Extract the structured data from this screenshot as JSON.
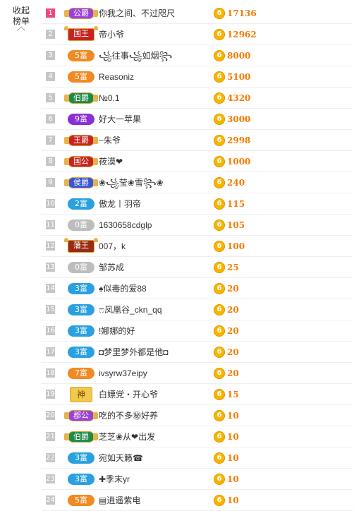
{
  "collapse_label": "收起榜单",
  "coin_glyph": "6",
  "rows": [
    {
      "rank": "1",
      "badge": "公爵",
      "badge_color": "#9b42d8",
      "badge_style": "wing",
      "name": "你我之间、不过咫尺",
      "score": "17136"
    },
    {
      "rank": "2",
      "badge": "国王",
      "badge_color": "#c8241f",
      "badge_style": "crown",
      "name": "帝小爷",
      "score": "12962"
    },
    {
      "rank": "3",
      "badge": "5富",
      "badge_color": "#f08a24",
      "badge_style": "plain",
      "name": "꧁往事꧁如烟꧂",
      "score": "8000"
    },
    {
      "rank": "4",
      "badge": "5富",
      "badge_color": "#f08a24",
      "badge_style": "plain",
      "name": "Reasoniz",
      "score": "5100"
    },
    {
      "rank": "5",
      "badge": "伯爵",
      "badge_color": "#1e8a4a",
      "badge_style": "wing",
      "name": "№0.1",
      "score": "4320"
    },
    {
      "rank": "6",
      "badge": "9富",
      "badge_color": "#8a2fd6",
      "badge_style": "plain",
      "name": "好大一苹果",
      "score": "3000"
    },
    {
      "rank": "7",
      "badge": "王爵",
      "badge_color": "#c8241f",
      "badge_style": "wing",
      "name": "~朱爷",
      "score": "2998"
    },
    {
      "rank": "8",
      "badge": "国公",
      "badge_color": "#c8241f",
      "badge_style": "wing",
      "name": "莜漠❤",
      "score": "1000"
    },
    {
      "rank": "9",
      "badge": "侯爵",
      "badge_color": "#3a56d4",
      "badge_style": "wing",
      "name": "❀꧁莹❀雪꧂❀",
      "score": "240"
    },
    {
      "rank": "10",
      "badge": "2富",
      "badge_color": "#2aa0de",
      "badge_style": "plain",
      "name": "傲龙丨羽帝",
      "score": "115"
    },
    {
      "rank": "11",
      "badge": "0富",
      "badge_color": "#bdbdbd",
      "badge_style": "plain",
      "name": "1630658cdglp",
      "score": "105"
    },
    {
      "rank": "12",
      "badge": "藩王",
      "badge_color": "#9a2a12",
      "badge_style": "crown",
      "name": "007，k",
      "score": "100"
    },
    {
      "rank": "13",
      "badge": "0富",
      "badge_color": "#bdbdbd",
      "badge_style": "plain",
      "name": "邹苏成",
      "score": "25"
    },
    {
      "rank": "14",
      "badge": "3富",
      "badge_color": "#2aa0de",
      "badge_style": "plain",
      "name": "♠似毒的爱88",
      "score": "20"
    },
    {
      "rank": "15",
      "badge": "3富",
      "badge_color": "#2aa0de",
      "badge_style": "plain",
      "name": "ෆ凤凰谷_ckn_qq",
      "score": "20"
    },
    {
      "rank": "16",
      "badge": "3富",
      "badge_color": "#2aa0de",
      "badge_style": "plain",
      "name": "!娜娜的好",
      "score": "20"
    },
    {
      "rank": "17",
      "badge": "3富",
      "badge_color": "#2aa0de",
      "badge_style": "plain",
      "name": "◘梦里梦外都是他◘",
      "score": "20"
    },
    {
      "rank": "18",
      "badge": "7富",
      "badge_color": "#f08a24",
      "badge_style": "plain",
      "name": "ivsyrw37eipy",
      "score": "20"
    },
    {
      "rank": "19",
      "badge": "神",
      "badge_color": "#f2c94c",
      "badge_style": "god",
      "name": "白嫖党・开心爷",
      "score": "15"
    },
    {
      "rank": "20",
      "badge": "郡公",
      "badge_color": "#9b42d8",
      "badge_style": "wing",
      "name": "吃的不多㊙好养",
      "score": "10"
    },
    {
      "rank": "21",
      "badge": "伯爵",
      "badge_color": "#1e8a4a",
      "badge_style": "wing",
      "name": "芝芝❀从❤出发",
      "score": "10"
    },
    {
      "rank": "22",
      "badge": "3富",
      "badge_color": "#2aa0de",
      "badge_style": "plain",
      "name": "宛如天籁☎",
      "score": "10"
    },
    {
      "rank": "23",
      "badge": "3富",
      "badge_color": "#2aa0de",
      "badge_style": "plain",
      "name": "✚季末yr",
      "score": "10"
    },
    {
      "rank": "24",
      "badge": "5富",
      "badge_color": "#f08a24",
      "badge_style": "plain",
      "name": "▤逍遥紫电",
      "score": "10"
    }
  ]
}
